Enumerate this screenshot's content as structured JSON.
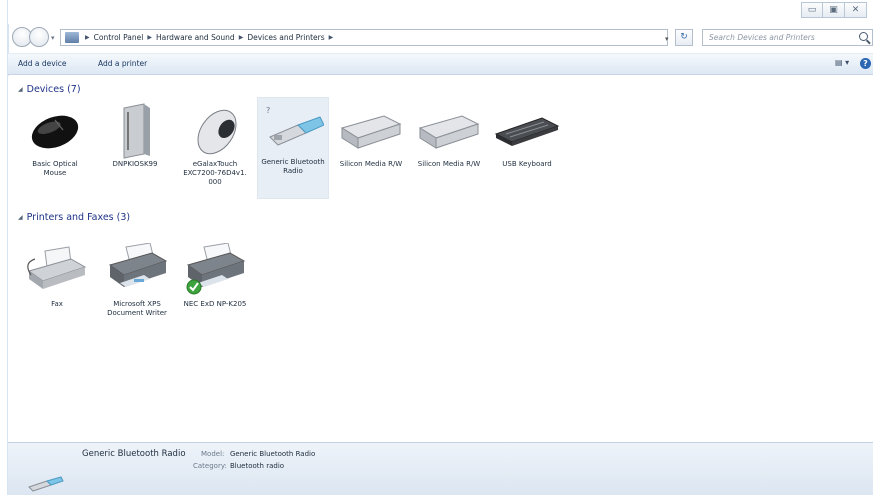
{
  "address": {
    "crumbs": [
      "Control Panel",
      "Hardware and Sound",
      "Devices and Printers"
    ],
    "search_placeholder": "Search Devices and Printers"
  },
  "toolbar": {
    "add_device": "Add a device",
    "add_printer": "Add a printer"
  },
  "groups": {
    "devices": {
      "title": "Devices (7)",
      "items": [
        {
          "label": "Basic Optical Mouse"
        },
        {
          "label": "DNPKIOSK99"
        },
        {
          "label": "eGalaxTouch EXC7200-76D4v1. 000"
        },
        {
          "label": "Generic Bluetooth Radio"
        },
        {
          "label": "Silicon Media R/W"
        },
        {
          "label": "Silicon Media R/W"
        },
        {
          "label": "USB Keyboard"
        }
      ]
    },
    "printers": {
      "title": "Printers and Faxes (3)",
      "items": [
        {
          "label": "Fax"
        },
        {
          "label": "Microsoft XPS Document Writer"
        },
        {
          "label": "NEC ExD NP-K205"
        }
      ]
    }
  },
  "details": {
    "name": "Generic Bluetooth Radio",
    "model_label": "Model:",
    "model_value": "Generic Bluetooth Radio",
    "category_label": "Category:",
    "category_value": "Bluetooth radio"
  },
  "colors": {
    "group_header": "#1e3287",
    "toolbar_bg": "#dde8f4",
    "selection": "#e8eef6"
  }
}
